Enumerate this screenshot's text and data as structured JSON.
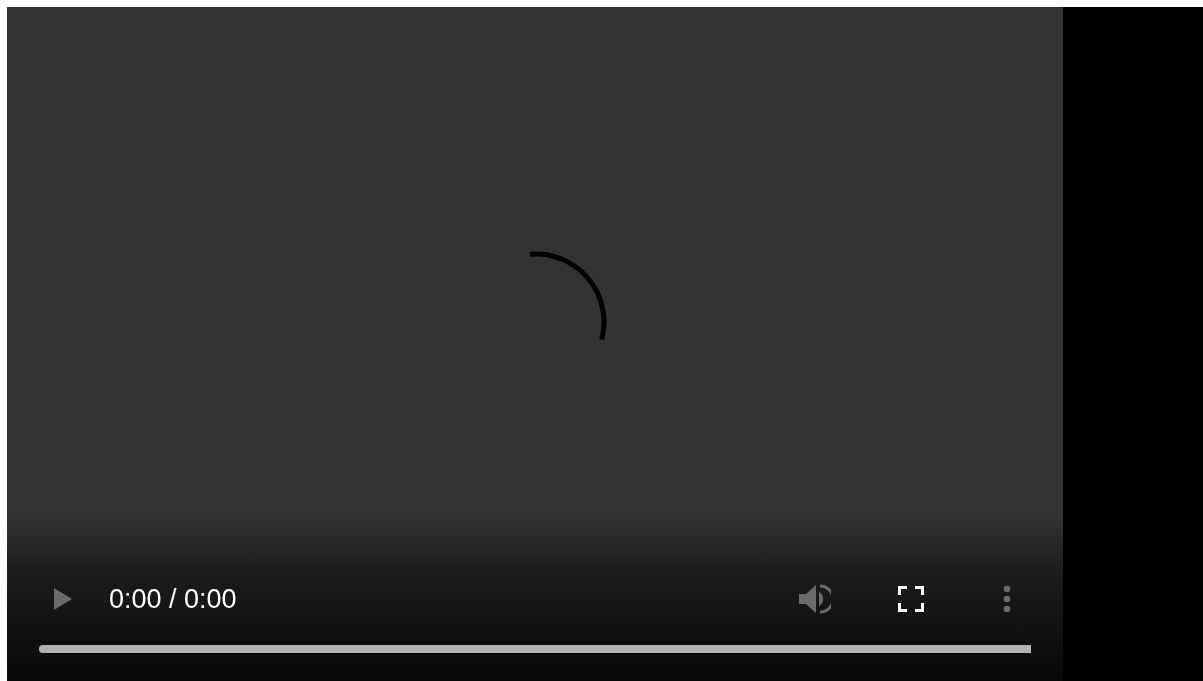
{
  "player": {
    "loading": true,
    "play_button": {
      "disabled": true
    },
    "time": "0:00 / 0:00",
    "volume_button": {
      "disabled": true
    },
    "fullscreen_button": {
      "disabled": false
    },
    "more_button": {
      "disabled": true
    },
    "progress": {
      "level": 0
    }
  }
}
